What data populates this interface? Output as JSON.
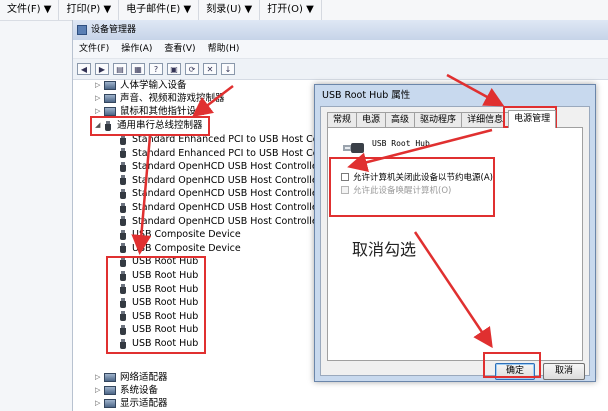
{
  "outer_menu": [
    {
      "label": "文件(F)",
      "arrow": "▼"
    },
    {
      "label": "打印(P)",
      "arrow": "▼"
    },
    {
      "label": "电子邮件(E)",
      "arrow": "▼"
    },
    {
      "label": "刻录(U)",
      "arrow": "▼"
    },
    {
      "label": "打开(O)",
      "arrow": "▼"
    }
  ],
  "device_manager": {
    "title": "设备管理器",
    "menu": [
      "文件(F)",
      "操作(A)",
      "查看(V)",
      "帮助(H)"
    ],
    "categories_top": [
      {
        "label": "人体学输入设备",
        "expander": "▷"
      },
      {
        "label": "声音、视频和游戏控制器",
        "expander": "▷"
      },
      {
        "label": "鼠标和其他指针设备",
        "expander": "▷"
      }
    ],
    "usb_category": {
      "label": "通用串行总线控制器",
      "expander": "◢"
    },
    "usb_devices": [
      "Standard Enhanced PCI to USB Host Controller",
      "Standard Enhanced PCI to USB Host Controller",
      "Standard OpenHCD USB Host Controller",
      "Standard OpenHCD USB Host Controller",
      "Standard OpenHCD USB Host Controller",
      "Standard OpenHCD USB Host Controller",
      "Standard OpenHCD USB Host Controller",
      "USB Composite Device",
      "USB Composite Device",
      "USB Root Hub",
      "USB Root Hub",
      "USB Root Hub",
      "USB Root Hub",
      "USB Root Hub",
      "USB Root Hub",
      "USB Root Hub"
    ],
    "categories_bottom": [
      {
        "label": "网络适配器",
        "expander": "▷"
      },
      {
        "label": "系统设备",
        "expander": "▷"
      },
      {
        "label": "显示适配器",
        "expander": "▷"
      }
    ]
  },
  "dialog": {
    "title": "USB Root Hub 属性",
    "tabs": [
      "常规",
      "电源",
      "高级",
      "驱动程序",
      "详细信息",
      "电源管理"
    ],
    "active_tab": "电源管理",
    "device_name": "USB Root Hub",
    "option_allow_off": "允许计算机关闭此设备以节约电源(A)",
    "option_allow_wake": "允许此设备唤醒计算机(O)",
    "annotation": "取消勾选",
    "ok_label": "确定",
    "cancel_label": "取消"
  },
  "colors": {
    "annotation_red": "#e03030",
    "titlebar": "#c8d9ee"
  }
}
